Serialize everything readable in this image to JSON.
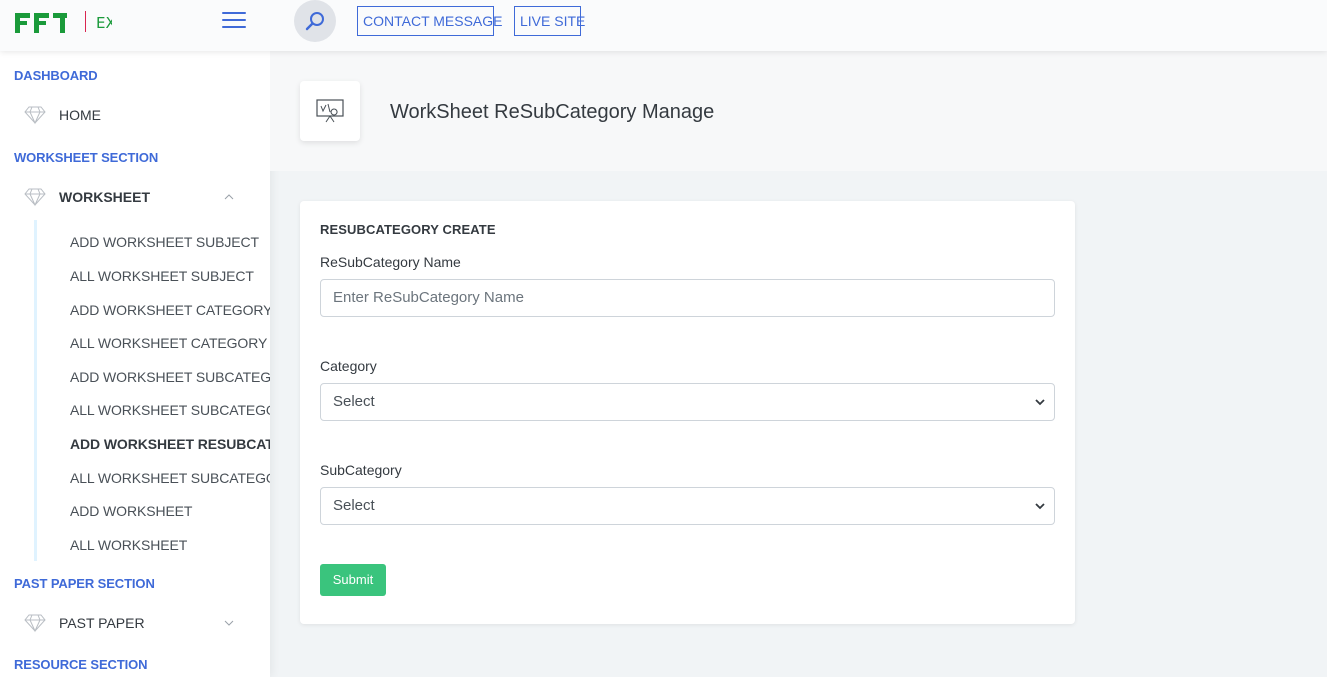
{
  "header": {
    "logo_text": "FFI",
    "logo_tag": "EX",
    "contact_label": "CONTACT MESSAGE",
    "live_site_label": "LIVE SITE"
  },
  "sidebar": {
    "dashboard_heading": "DASHBOARD",
    "home_label": "HOME",
    "worksheet_heading": "WORKSHEET SECTION",
    "worksheet_label": "WORKSHEET",
    "worksheet_items": [
      "ADD WORKSHEET SUBJECT",
      "ALL WORKSHEET SUBJECT",
      "ADD WORKSHEET CATEGORY",
      "ALL WORKSHEET CATEGORY",
      "ADD WORKSHEET SUBCATEGORY",
      "ALL WORKSHEET SUBCATEGORY",
      "ADD WORKSHEET RESUBCATEGORY",
      "ALL WORKSHEET SUBCATEGORY",
      "ADD WORKSHEET",
      "ALL WORKSHEET"
    ],
    "active_index": 6,
    "past_paper_heading": "PAST PAPER SECTION",
    "past_paper_label": "PAST PAPER",
    "resource_heading": "RESOURCE SECTION"
  },
  "page": {
    "title": "WorkSheet ReSubCategory Manage"
  },
  "form": {
    "card_title": "RESUBCATEGORY CREATE",
    "name_label": "ReSubCategory Name",
    "name_placeholder": "Enter ReSubCategory Name",
    "category_label": "Category",
    "category_value": "Select",
    "subcategory_label": "SubCategory",
    "subcategory_value": "Select",
    "submit_label": "Submit"
  },
  "colors": {
    "accent": "#3f6ad8",
    "success": "#3ac47d",
    "logo_green": "#1a9a3a"
  }
}
